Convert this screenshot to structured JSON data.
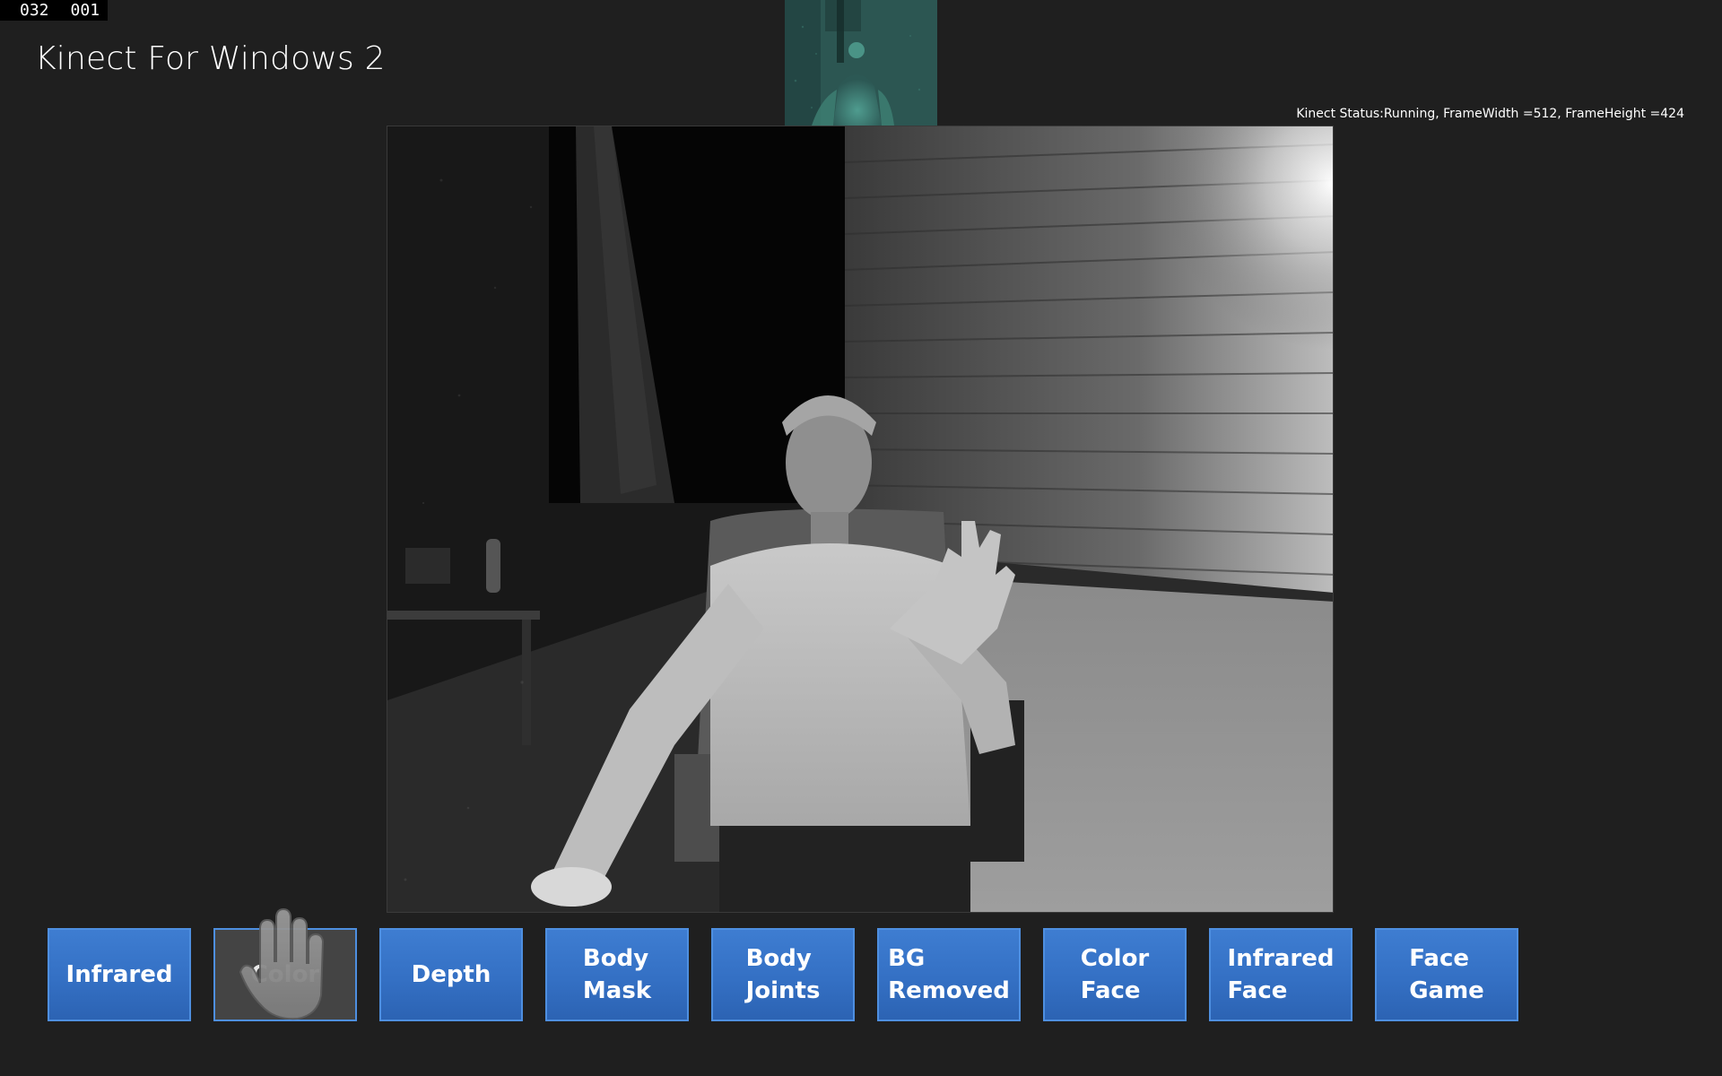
{
  "counter": {
    "left": "032",
    "right": "001"
  },
  "app": {
    "title": "Kinect For Windows 2"
  },
  "status": {
    "text": "Kinect Status:Running, FrameWidth =512, FrameHeight =424"
  },
  "buttons": [
    {
      "label": "Infrared",
      "state": "normal"
    },
    {
      "label": "Color",
      "state": "hovered"
    },
    {
      "label": "Depth",
      "state": "normal"
    },
    {
      "label": "Body\nMask",
      "state": "normal"
    },
    {
      "label": "Body\nJoints",
      "state": "normal"
    },
    {
      "label": "BG\nRemoved",
      "state": "normal"
    },
    {
      "label": "Color\nFace",
      "state": "normal"
    },
    {
      "label": "Infrared\nFace",
      "state": "normal"
    },
    {
      "label": "Face\nGame",
      "state": "normal"
    }
  ],
  "colors": {
    "background": "#1f1f1f",
    "button_blue": "#3470c4",
    "button_border": "#4e8fe0",
    "button_hover": "#444444",
    "depth_teal": "#2a5350"
  },
  "icons": {
    "cursor": "hand-cursor-icon"
  }
}
